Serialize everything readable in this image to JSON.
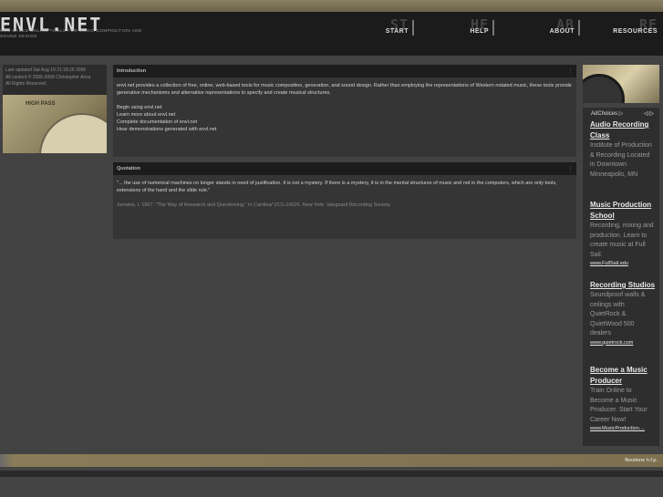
{
  "site": {
    "logo": "ENVL.NET",
    "tagline": "Web-based online tools for music composition and sound design"
  },
  "nav": [
    {
      "big": "ST",
      "label": "START"
    },
    {
      "big": "HE",
      "label": "HELP"
    },
    {
      "big": "AB",
      "label": "ABOUT"
    },
    {
      "big": "RE",
      "label": "RESOURCES"
    }
  ],
  "sidebar_left": {
    "updated": "Last updated Sat Aug 19 21:18:26 2006",
    "copyright": "All content © 2006-2008 Christopher Ariza",
    "rights": "All Rights Reserved.",
    "image_text": "HIGH PASS"
  },
  "intro": {
    "heading": "Introduction",
    "body": "envl.net provides a collection of free, online, web-based tools for music composition, generation, and sound design. Rather than employing the representations of Western notated music, these tools provide generative mechanisms and alternative representations to specify and create musical structures.",
    "links": [
      "Begin using envl.net",
      "Learn more about envl.net",
      "Complete documentation of envl.net",
      "Hear demonstrations generated with envl.net"
    ]
  },
  "quotation": {
    "heading": "Quotation",
    "quote": "\"... the use of numerical machines no longer stands in need of justification. It is not a mystery. If there is a mystery, it is in the mental structures of music and not in the computers, which are only tools, extensions of the hand and the slide rule.\"",
    "cite_a": "Xenakis, I. 1967. \"The Way of Research and Questioning.\" In ",
    "cite_b": "Cardinal VCS-10026",
    "cite_c": ". New York: Vanguard Recording Society."
  },
  "ads": {
    "adchoices": "AdChoices ▷",
    "arrows": "◁ ▷",
    "items": [
      {
        "title": "Audio Recording Class",
        "desc": "Institute of Production & Recording Located in Downtown Minneapolis, MN",
        "url": ""
      },
      {
        "title": "Music Production School",
        "desc": "Recording, mixing and production. Learn to create music at Full Sail.",
        "url": "www.FullSail.edu"
      },
      {
        "title": "Recording Studios",
        "desc": "Soundproof walls & ceilings with QuietRock & QuietWood 500 dealers",
        "url": "www.quietrock.com"
      },
      {
        "title": "Become a Music Producer",
        "desc": "Train Online to Become a Music Producer. Start Your Career Now!",
        "url": "www.MusicProduction...."
      }
    ]
  },
  "footer": {
    "text": "flexstone h.f.p."
  }
}
